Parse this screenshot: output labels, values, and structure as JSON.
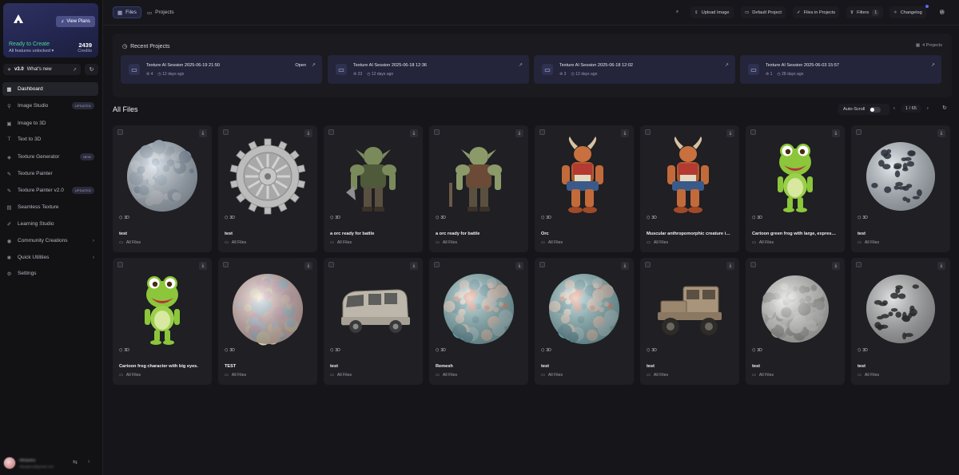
{
  "plan": {
    "view_plans": "View Plans",
    "status": "Ready to Create",
    "sub": "All features unlocked",
    "credits": "2439",
    "credits_label": "Credits"
  },
  "version": {
    "label": "v3.0",
    "whats_new": "What's new"
  },
  "nav": [
    {
      "label": "Dashboard",
      "icon": "grid-icon",
      "badge": "",
      "chevron": false,
      "active": true
    },
    {
      "label": "Image Studio",
      "icon": "image-studio-icon",
      "badge": "UPDATED",
      "chevron": false,
      "active": false
    },
    {
      "label": "Image to 3D",
      "icon": "image-icon",
      "badge": "",
      "chevron": false,
      "active": false
    },
    {
      "label": "Text to 3D",
      "icon": "text-icon",
      "badge": "",
      "chevron": false,
      "active": false
    },
    {
      "label": "Texture Generator",
      "icon": "texture-icon",
      "badge": "NEW",
      "chevron": false,
      "active": false
    },
    {
      "label": "Texture Painter",
      "icon": "brush-icon",
      "badge": "",
      "chevron": false,
      "active": false
    },
    {
      "label": "Texture Painter v2.0",
      "icon": "brush-v2-icon",
      "badge": "UPDATED",
      "chevron": false,
      "active": false
    },
    {
      "label": "Seamless Texture",
      "icon": "seamless-icon",
      "badge": "",
      "chevron": false,
      "active": false
    },
    {
      "label": "Learning Studio",
      "icon": "learning-icon",
      "badge": "",
      "chevron": false,
      "active": false
    },
    {
      "label": "Community Creations",
      "icon": "community-icon",
      "badge": "",
      "chevron": true,
      "active": false
    },
    {
      "label": "Quick Utilities",
      "icon": "utilities-icon",
      "badge": "",
      "chevron": true,
      "active": false
    },
    {
      "label": "Settings",
      "icon": "gear-icon",
      "badge": "",
      "chevron": false,
      "active": false
    }
  ],
  "user": {
    "name": "nikopanu",
    "email": "nikopanu@gmail.com"
  },
  "topbar": {
    "tab_files": "Files",
    "tab_projects": "Projects",
    "upload": "Upload Image",
    "default_project": "Default Project",
    "files_in_projects": "Files in Projects",
    "filters": "Filters",
    "filters_count": "1",
    "changelog": "Changelog"
  },
  "recent": {
    "title": "Recent Projects",
    "count": "4 Projects",
    "projects": [
      {
        "name": "Texture AI Session 2025-06-19 21:50",
        "items": "4",
        "ago": "12 days ago",
        "open": "Open"
      },
      {
        "name": "Texture AI Session 2025-06-18 12:36",
        "items": "23",
        "ago": "12 days ago",
        "open": ""
      },
      {
        "name": "Texture AI Session 2025-06-18 12:02",
        "items": "3",
        "ago": "13 days ago",
        "open": ""
      },
      {
        "name": "Texture AI Session 2025-06-03 15:57",
        "items": "1",
        "ago": "28 days ago",
        "open": ""
      }
    ]
  },
  "files": {
    "title": "All Files",
    "autoscroll": "Auto-Scroll",
    "page": "1 / 65",
    "items": [
      {
        "title": "test",
        "tag": "3D",
        "folder": "All Files",
        "thumb": "ball-flowers"
      },
      {
        "title": "test",
        "tag": "3D",
        "folder": "All Files",
        "thumb": "gear"
      },
      {
        "title": "a orc ready for battle",
        "tag": "3D",
        "folder": "All Files",
        "thumb": "orc-green"
      },
      {
        "title": "a orc ready for battle",
        "tag": "3D",
        "folder": "All Files",
        "thumb": "orc-armored"
      },
      {
        "title": "Orc",
        "tag": "3D",
        "folder": "All Files",
        "thumb": "creature"
      },
      {
        "title": "Muscular anthropomorphic creature in a...",
        "tag": "3D",
        "folder": "All Files",
        "thumb": "creature"
      },
      {
        "title": "Cartoon green frog with large, expressiv...",
        "tag": "3D",
        "folder": "All Files",
        "thumb": "frog"
      },
      {
        "title": "test",
        "tag": "3D",
        "folder": "All Files",
        "thumb": "lattice"
      },
      {
        "title": "Cartoon frog character with big eyes.",
        "tag": "3D",
        "folder": "All Files",
        "thumb": "frog"
      },
      {
        "title": "TEST",
        "tag": "3D",
        "folder": "All Files",
        "thumb": "ball-pastel"
      },
      {
        "title": "test",
        "tag": "3D",
        "folder": "All Files",
        "thumb": "van"
      },
      {
        "title": "Remesh",
        "tag": "3D",
        "folder": "All Files",
        "thumb": "ball-teal"
      },
      {
        "title": "test",
        "tag": "3D",
        "folder": "All Files",
        "thumb": "ball-teal"
      },
      {
        "title": "test",
        "tag": "3D",
        "folder": "All Files",
        "thumb": "truck"
      },
      {
        "title": "test",
        "tag": "3D",
        "folder": "All Files",
        "thumb": "ball-white"
      },
      {
        "title": "test",
        "tag": "3D",
        "folder": "All Files",
        "thumb": "lattice-grey"
      }
    ]
  },
  "colors": {
    "accent": "#5a6cf0",
    "ready": "#4ed79a",
    "bg": "#16161a",
    "card": "#1f1f24"
  }
}
